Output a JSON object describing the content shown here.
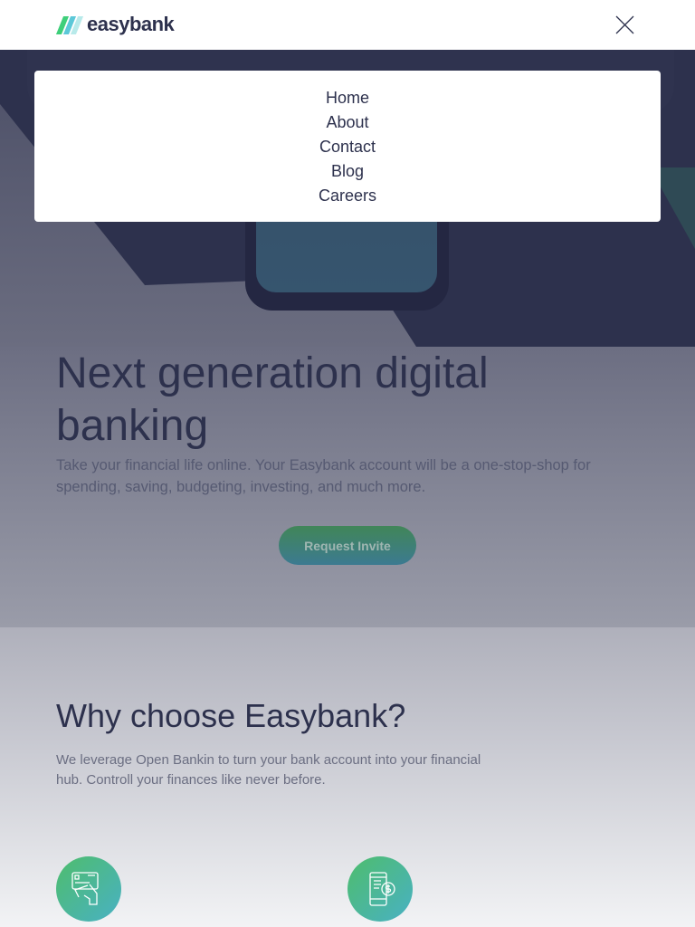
{
  "header": {
    "logo_text": "easybank",
    "close_label": "Close menu"
  },
  "menu": {
    "items": [
      "Home",
      "About",
      "Contact",
      "Blog",
      "Careers"
    ]
  },
  "hero": {
    "title": "Next generation digital banking",
    "description": "Take your financial life online. Your Easybank account will be a one-stop-shop for spending, saving, budgeting, investing, and much more.",
    "cta_label": "Request Invite"
  },
  "why": {
    "title": "Why choose Easybank?",
    "description": "We leverage Open Bankin to turn your bank account into your financial hub. Controll your finances like never before.",
    "features": [
      {
        "icon": "card-hand-icon"
      },
      {
        "icon": "phone-dollar-icon"
      }
    ]
  },
  "colors": {
    "navy": "#2d314d",
    "green": "#31d35c",
    "cyan": "#2bb7da"
  }
}
